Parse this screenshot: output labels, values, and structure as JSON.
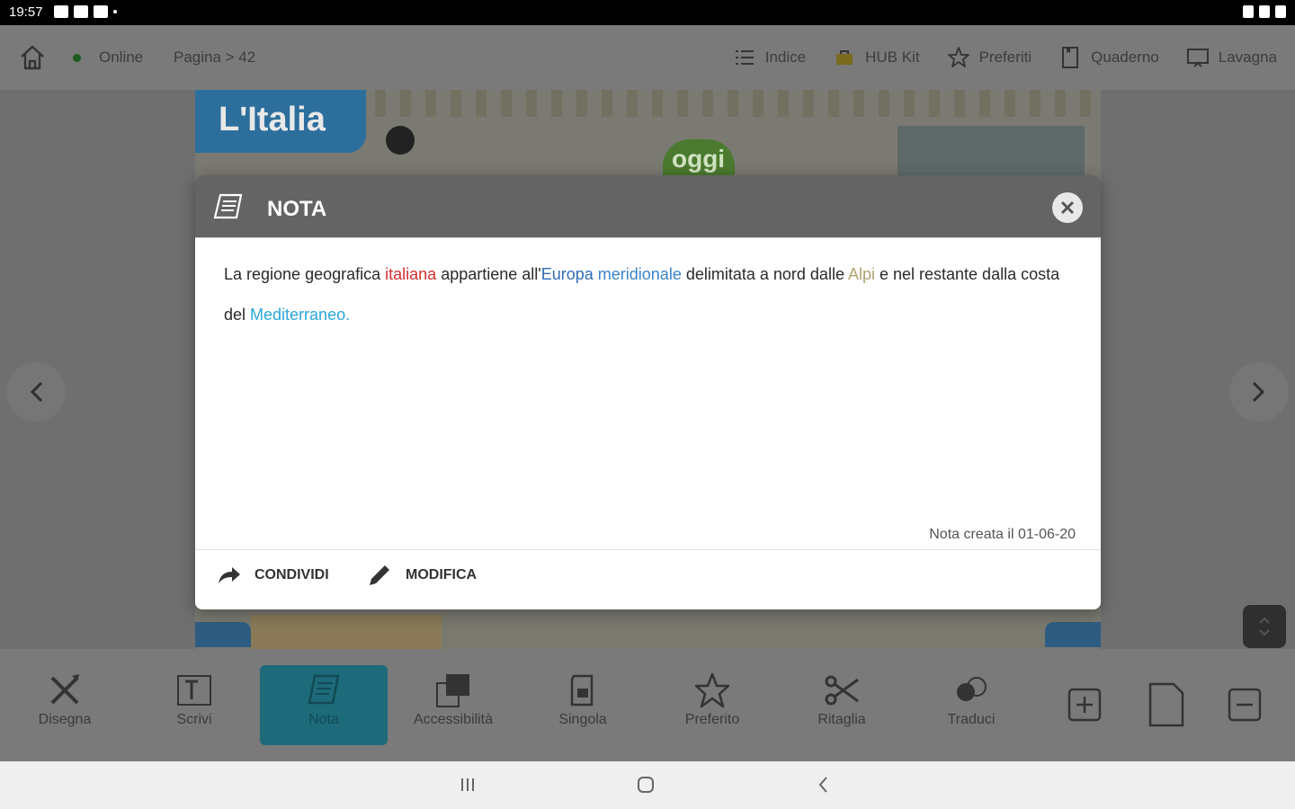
{
  "status_bar": {
    "time": "19:57"
  },
  "top_nav": {
    "online_label": "Online",
    "page_label": "Pagina > 42",
    "items": [
      {
        "label": "Indice",
        "icon": "list-icon"
      },
      {
        "label": "HUB Kit",
        "icon": "hub-kit-icon"
      },
      {
        "label": "Preferiti",
        "icon": "star-icon"
      },
      {
        "label": "Quaderno",
        "icon": "notebook-icon"
      },
      {
        "label": "Lavagna",
        "icon": "board-icon"
      }
    ]
  },
  "book": {
    "title": "L'Italia",
    "oggi": "oggi"
  },
  "modal": {
    "title": "NOTA",
    "text": {
      "p1": "La regione geografica ",
      "w1": "italiana",
      "p2": " appartiene all'",
      "w2": "Europa",
      "p3": " ",
      "w3": "meridionale",
      "p4": " delimitata a nord dalle ",
      "w4": "Alpi",
      "p5": " e nel restante dalla costa del ",
      "w5": "Mediterraneo",
      "p6": "."
    },
    "created": "Nota creata il 01-06-20",
    "share_label": "CONDIVIDI",
    "edit_label": "MODIFICA"
  },
  "toolbar": {
    "tools": [
      {
        "label": "Disegna",
        "icon": "draw-icon"
      },
      {
        "label": "Scrivi",
        "icon": "text-icon"
      },
      {
        "label": "Nota",
        "icon": "note-icon",
        "active": true
      },
      {
        "label": "Accessibilità",
        "icon": "accessibility-icon"
      },
      {
        "label": "Singola",
        "icon": "single-page-icon"
      },
      {
        "label": "Preferito",
        "icon": "star-icon"
      },
      {
        "label": "Ritaglia",
        "icon": "scissors-icon"
      },
      {
        "label": "Traduci",
        "icon": "translate-icon"
      }
    ]
  },
  "colors": {
    "modal_header": "#646464",
    "active_tool": "#1d6a7a",
    "highlight_red": "#d52d2d",
    "highlight_blue": "#2e6db4",
    "highlight_olive": "#b0a370",
    "highlight_cyan": "#2aa7d9"
  }
}
